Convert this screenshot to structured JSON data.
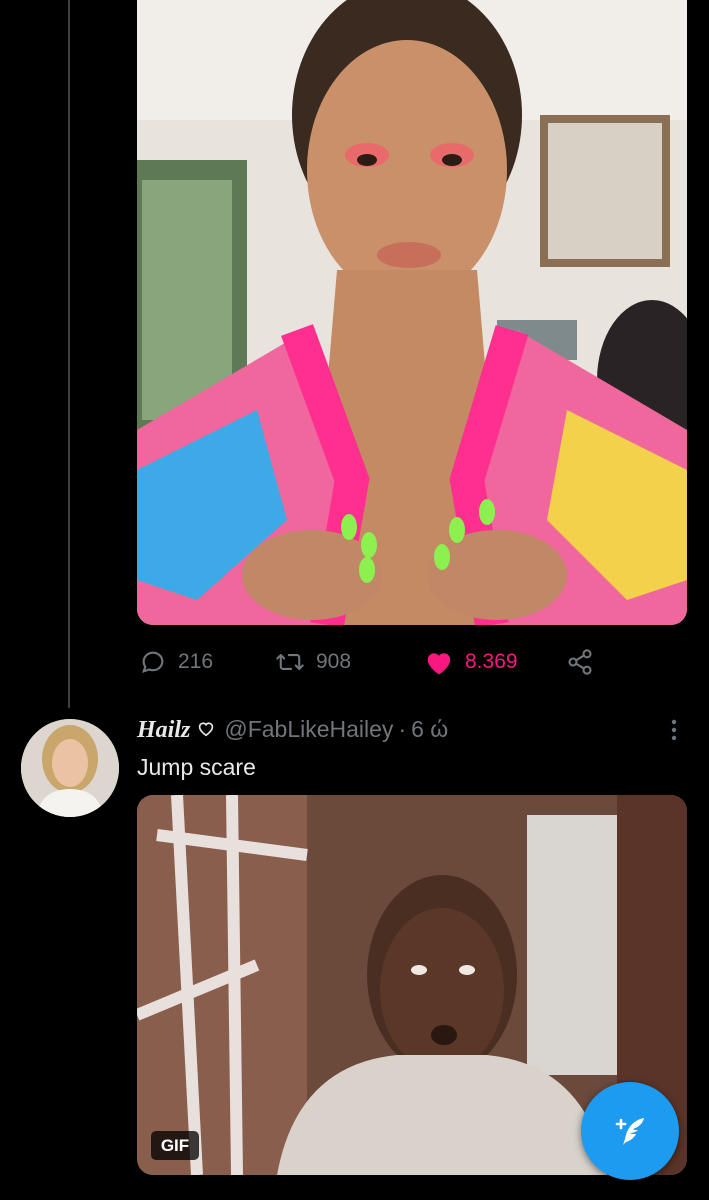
{
  "colors": {
    "background": "#000000",
    "muted": "#71767b",
    "like": "#f91880",
    "accent": "#1d9bf0",
    "text": "#e7e9ea"
  },
  "tweet1": {
    "actions": {
      "replies": "216",
      "retweets": "908",
      "likes": "8.369",
      "liked": true,
      "reply_icon": "reply-icon",
      "retweet_icon": "retweet-icon",
      "like_icon": "heart-filled-icon",
      "share_icon": "share-icon"
    }
  },
  "tweet2": {
    "display_name": "Hailz",
    "name_icon": "heart-outline-icon",
    "handle": "@FabLikeHailey",
    "separator": "·",
    "time": "6 ώ",
    "text": "Jump scare",
    "media_badge": "GIF",
    "more_icon": "more-vertical-icon"
  },
  "compose_button": {
    "icon": "compose-feather-icon"
  }
}
